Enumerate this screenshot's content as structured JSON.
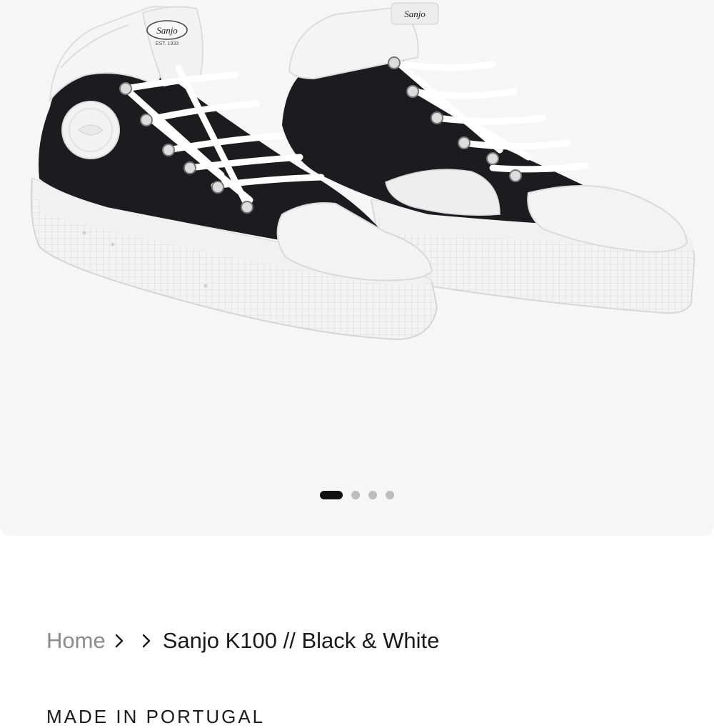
{
  "gallery": {
    "image_alt": "Sanjo K100 Black & White high-top sneakers",
    "logo_text": "Sanjo",
    "logo_subtext": "EST. 1933",
    "slides_total": 4,
    "active_slide": 1,
    "colors": {
      "background": "#f6f6f6",
      "canvas": "#1c1c1f",
      "rubber": "#f2f2f2",
      "dot_active": "#111111",
      "dot_inactive": "#bdbdbd"
    }
  },
  "breadcrumb": {
    "home_label": "Home",
    "current_label": "Sanjo K100 // Black & White"
  },
  "section": {
    "label": "MADE IN PORTUGAL"
  }
}
